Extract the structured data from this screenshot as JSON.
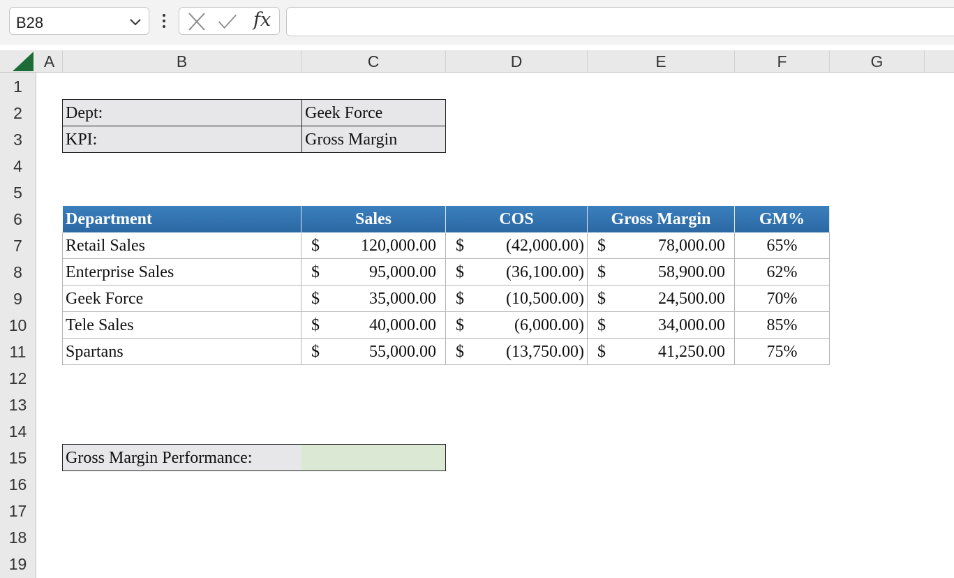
{
  "formula_bar": {
    "name_box": "B28",
    "fx_label": "fx",
    "formula": ""
  },
  "columns": [
    "A",
    "B",
    "C",
    "D",
    "E",
    "F",
    "G"
  ],
  "rows": [
    "1",
    "2",
    "3",
    "4",
    "5",
    "6",
    "7",
    "8",
    "9",
    "10",
    "11",
    "12",
    "13",
    "14",
    "15",
    "16",
    "17",
    "18",
    "19"
  ],
  "info": {
    "dept_label": "Dept:",
    "dept_value": "Geek Force",
    "kpi_label": "KPI:",
    "kpi_value": "Gross Margin"
  },
  "table": {
    "headers": [
      "Department",
      "Sales",
      "COS",
      "Gross Margin",
      "GM%"
    ],
    "currency": "$",
    "rows": [
      {
        "dept": "Retail Sales",
        "sales": "120,000.00",
        "cos": "(42,000.00)",
        "gm": "78,000.00",
        "pct": "65%"
      },
      {
        "dept": "Enterprise Sales",
        "sales": "95,000.00",
        "cos": "(36,100.00)",
        "gm": "58,900.00",
        "pct": "62%"
      },
      {
        "dept": "Geek Force",
        "sales": "35,000.00",
        "cos": "(10,500.00)",
        "gm": "24,500.00",
        "pct": "70%"
      },
      {
        "dept": "Tele Sales",
        "sales": "40,000.00",
        "cos": "(6,000.00)",
        "gm": "34,000.00",
        "pct": "85%"
      },
      {
        "dept": "Spartans",
        "sales": "55,000.00",
        "cos": "(13,750.00)",
        "gm": "41,250.00",
        "pct": "75%"
      }
    ]
  },
  "performance": {
    "label": "Gross Margin Performance:",
    "value": ""
  },
  "colors": {
    "header_fill": "#2f6ea8",
    "info_fill": "#e7e7ea",
    "performance_fill": "#dae8d4",
    "excel_green": "#1e6b3a"
  }
}
